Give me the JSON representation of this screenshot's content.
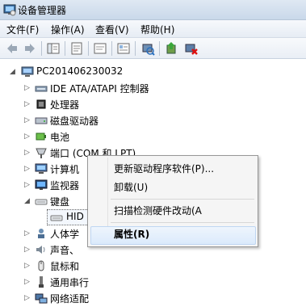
{
  "window": {
    "title": "设备管理器",
    "icon": "device-manager-icon"
  },
  "menubar": {
    "items": [
      "文件(F)",
      "操作(A)",
      "查看(V)",
      "帮助(H)"
    ]
  },
  "toolbar": {
    "buttons": [
      "back-arrow-icon",
      "forward-arrow-icon",
      "show-hide-console-tree-icon",
      "properties-icon",
      "help-icon",
      "scan-hardware-icon",
      "update-driver-icon",
      "uninstall-icon"
    ]
  },
  "tree": {
    "root": "PC201406230032",
    "items": [
      {
        "label": "IDE ATA/ATAPI 控制器",
        "icon": "ide-controller-icon",
        "expanded": false
      },
      {
        "label": "处理器",
        "icon": "processor-icon",
        "expanded": false
      },
      {
        "label": "磁盘驱动器",
        "icon": "disk-drive-icon",
        "expanded": false
      },
      {
        "label": "电池",
        "icon": "battery-icon",
        "expanded": false
      },
      {
        "label": "端口 (COM 和 LPT)",
        "icon": "port-icon",
        "expanded": false
      },
      {
        "label": "计算机",
        "icon": "computer-icon",
        "expanded": false
      },
      {
        "label": "监视器",
        "icon": "monitor-icon",
        "expanded": false
      },
      {
        "label": "键盘",
        "icon": "keyboard-icon",
        "expanded": true
      },
      {
        "label": "HID",
        "icon": "keyboard-icon",
        "selected": true
      },
      {
        "label": "人体学",
        "icon": "hid-device-icon",
        "expanded": false
      },
      {
        "label": "声音、",
        "icon": "sound-icon",
        "expanded": false
      },
      {
        "label": "鼠标和",
        "icon": "mouse-icon",
        "expanded": false
      },
      {
        "label": "通用串行",
        "icon": "usb-icon",
        "expanded": false
      },
      {
        "label": "网络适配",
        "icon": "network-adapter-icon",
        "expanded": false
      }
    ]
  },
  "context_menu": {
    "items": [
      "更新驱动程序软件(P)...",
      "卸载(U)",
      "扫描检测硬件改动(A",
      "属性(R)"
    ],
    "highlighted": "属性(R)"
  },
  "colors": {
    "title_bg": "#c9d8ea",
    "menu_bg": "#f5f5f5",
    "highlight": "#dbeafb"
  }
}
